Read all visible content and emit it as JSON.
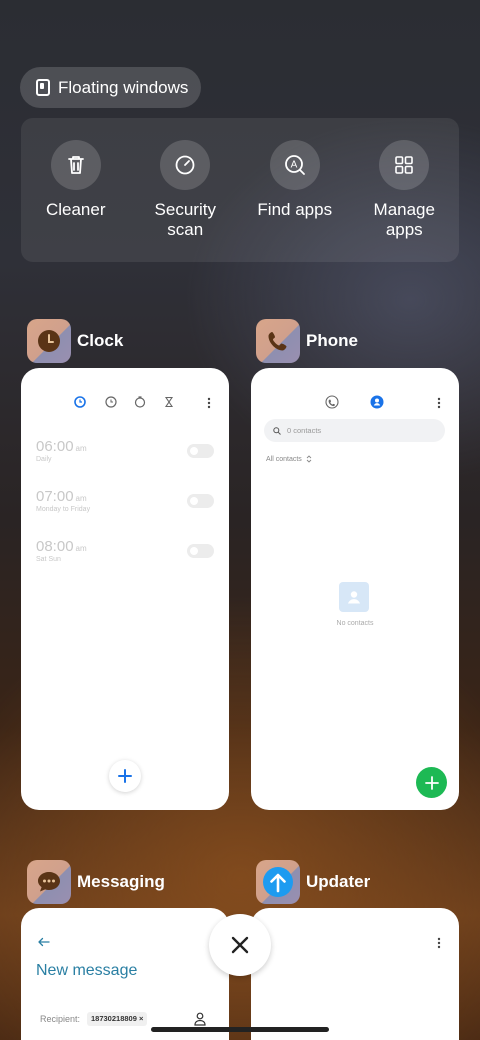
{
  "floating_windows": {
    "label": "Floating windows"
  },
  "tools": [
    {
      "label": "Cleaner",
      "icon": "trash-icon"
    },
    {
      "label": "Security scan",
      "icon": "security-scan-icon"
    },
    {
      "label": "Find apps",
      "icon": "find-apps-icon"
    },
    {
      "label": "Manage apps",
      "icon": "grid-icon"
    }
  ],
  "apps": {
    "clock": {
      "name": "Clock",
      "alarms": [
        {
          "time": "06:00",
          "ampm": "am",
          "repeat": "Daily"
        },
        {
          "time": "07:00",
          "ampm": "am",
          "repeat": "Monday to Friday"
        },
        {
          "time": "08:00",
          "ampm": "am",
          "repeat": "Sat Sun"
        }
      ]
    },
    "phone": {
      "name": "Phone",
      "search_placeholder": "0 contacts",
      "filter_label": "All contacts",
      "empty_text": "No contacts"
    },
    "messaging": {
      "name": "Messaging",
      "title": "New message",
      "recipient_label": "Recipient:",
      "recipient_chip": "18730218809 ×"
    },
    "updater": {
      "name": "Updater"
    }
  },
  "colors": {
    "accent_blue": "#1a73e8",
    "fab_green": "#1db954"
  }
}
